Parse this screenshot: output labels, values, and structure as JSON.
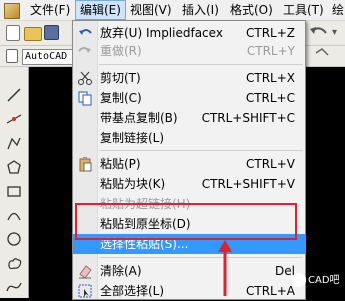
{
  "menubar": {
    "items": [
      {
        "label": "文件(F)"
      },
      {
        "label": "编辑(E)"
      },
      {
        "label": "视图(V)"
      },
      {
        "label": "插入(I)"
      },
      {
        "label": "格式(O)"
      },
      {
        "label": "工具(T)"
      },
      {
        "label": "绘"
      }
    ]
  },
  "toolbar": {
    "command_box_value": "AutoCAD 经"
  },
  "edit_menu": {
    "items": [
      {
        "label": "放弃(U) Impliedfacex",
        "shortcut": "CTRL+Z"
      },
      {
        "label": "重做(R)",
        "shortcut": "CTRL+Y"
      },
      {
        "label": "剪切(T)",
        "shortcut": "CTRL+X"
      },
      {
        "label": "复制(C)",
        "shortcut": "CTRL+C"
      },
      {
        "label": "带基点复制(B)",
        "shortcut": "CTRL+SHIFT+C"
      },
      {
        "label": "复制链接(L)",
        "shortcut": ""
      },
      {
        "label": "粘贴(P)",
        "shortcut": "CTRL+V"
      },
      {
        "label": "粘贴为块(K)",
        "shortcut": "CTRL+SHIFT+V"
      },
      {
        "label": "粘贴为超链接(H)",
        "shortcut": ""
      },
      {
        "label": "粘贴到原坐标(D)",
        "shortcut": ""
      },
      {
        "label": "选择性粘贴(S)...",
        "shortcut": ""
      },
      {
        "label": "清除(A)",
        "shortcut": "Del"
      },
      {
        "label": "全部选择(L)",
        "shortcut": "CTRL+A"
      }
    ]
  },
  "watermark": {
    "text": "CAD吧"
  },
  "colors": {
    "highlight": "#3399ff",
    "annotation": "#e0232a"
  }
}
